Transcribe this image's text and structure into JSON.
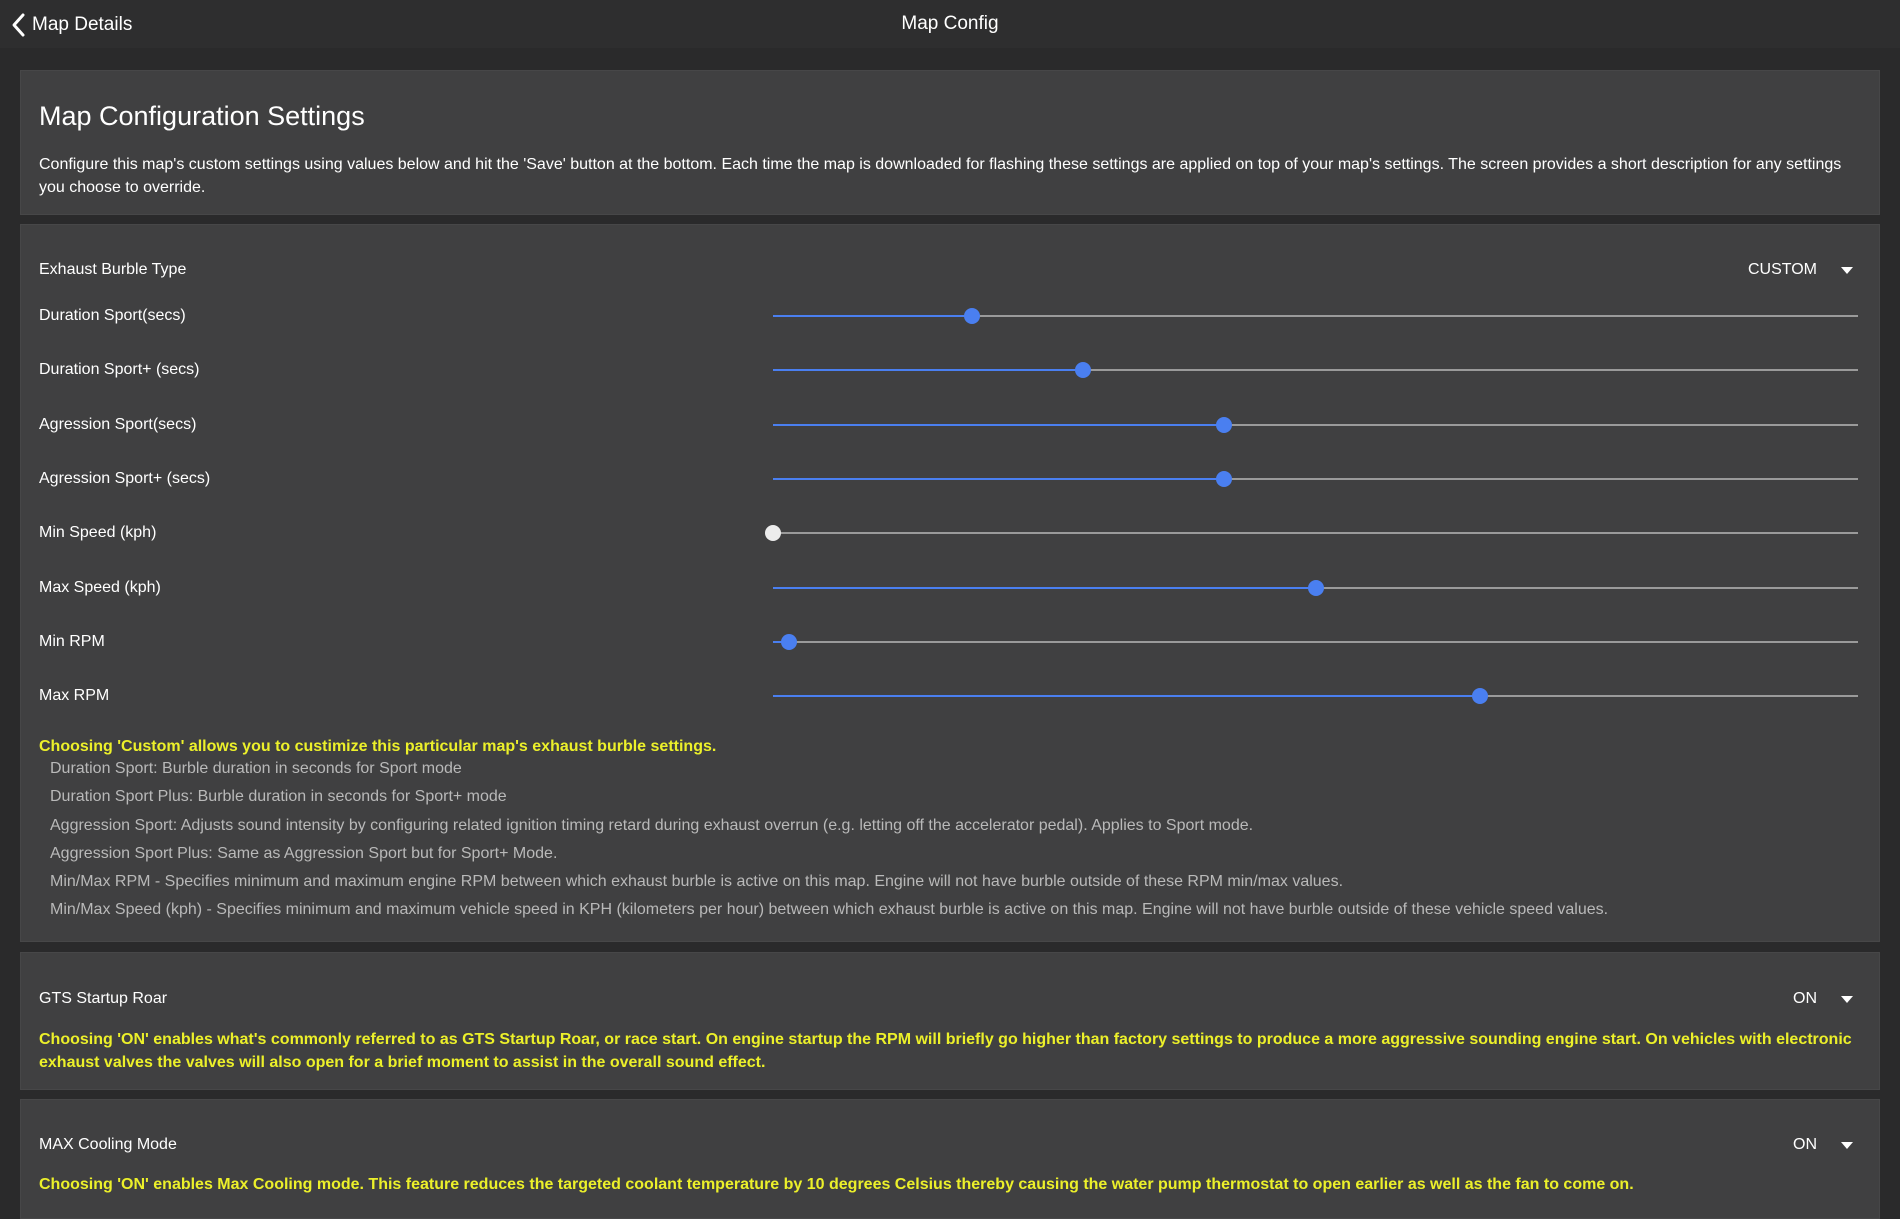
{
  "header": {
    "back_label": "Map Details",
    "title": "Map Config"
  },
  "intro": {
    "heading": "Map Configuration Settings",
    "description": "Configure this map's custom settings using values below and hit the 'Save' button at the bottom. Each time the map is downloaded for flashing these settings are applied on top of your map's settings. The screen provides a short description for any settings you choose to override."
  },
  "burble": {
    "label": "Exhaust Burble Type",
    "selected": "CUSTOM",
    "sliders": [
      {
        "label": "Duration Sport(secs)",
        "level": 0.183
      },
      {
        "label": "Duration Sport+ (secs)",
        "level": 0.286
      },
      {
        "label": "Agression Sport(secs)",
        "level": 0.416
      },
      {
        "label": "Agression Sport+ (secs)",
        "level": 0.416
      },
      {
        "label": "Min Speed (kph)",
        "level": 0.0
      },
      {
        "label": "Max Speed (kph)",
        "level": 0.5
      },
      {
        "label": "Min RPM",
        "level": 0.015
      },
      {
        "label": "Max RPM",
        "level": 0.652
      }
    ],
    "note": "Choosing 'Custom' allows you to custimize this particular map's exhaust burble settings.",
    "details": [
      "Duration Sport: Burble duration in seconds for Sport mode",
      "Duration Sport Plus: Burble duration in seconds for Sport+ mode",
      "Aggression Sport: Adjusts sound intensity by configuring related ignition timing retard during exhaust overrun (e.g. letting off the accelerator pedal). Applies to Sport mode.",
      "Aggression Sport Plus: Same as Aggression Sport but for Sport+ Mode.",
      "Min/Max RPM - Specifies minimum and maximum engine RPM between which exhaust burble is active on this map. Engine will not have burble outside of these RPM min/max values.",
      "Min/Max Speed (kph) - Specifies minimum and maximum vehicle speed in KPH (kilometers per hour) between which exhaust burble is active on this map. Engine will not have burble outside of these vehicle speed values."
    ]
  },
  "roar": {
    "label": "GTS Startup Roar",
    "selected": "ON",
    "note": "Choosing 'ON' enables what's commonly referred to as GTS Startup Roar, or race start. On engine startup the RPM will briefly go higher than factory settings to produce a more aggressive sounding engine start. On vehicles with electronic exhaust valves the valves will also open for a brief moment to assist in the overall sound effect."
  },
  "cooling": {
    "label": "MAX Cooling Mode",
    "selected": "ON",
    "note": "Choosing 'ON' enables Max Cooling mode. This feature reduces the targeted coolant temperature by 10 degrees Celsius thereby causing the water pump thermostat to open earlier as well as the fan to come on."
  }
}
